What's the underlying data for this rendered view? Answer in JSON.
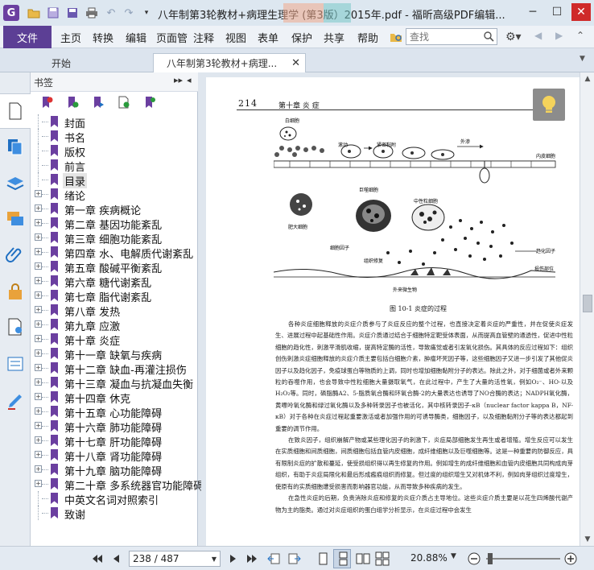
{
  "window": {
    "title": "八年制第3轮教材+病理生理学 (第3版）2015年.pdf - 福昕高级PDF编辑...",
    "app_logo_letter": "G"
  },
  "menubar": {
    "file": "文件",
    "items": [
      "主页",
      "转换",
      "编辑",
      "页面管",
      "注释",
      "视图",
      "表单",
      "保护",
      "共享",
      "帮助"
    ],
    "search_placeholder": "查找"
  },
  "tabs": {
    "start": "开始",
    "doc": "八年制第3轮教材+病理..."
  },
  "bookmarks": {
    "title": "书签",
    "items": [
      {
        "label": "封面",
        "expandable": false
      },
      {
        "label": "书名",
        "expandable": false
      },
      {
        "label": "版权",
        "expandable": false
      },
      {
        "label": "前言",
        "expandable": false
      },
      {
        "label": "目录",
        "expandable": false,
        "selected": true
      },
      {
        "label": "绪论",
        "expandable": true
      },
      {
        "label": "第一章  疾病概论",
        "expandable": true
      },
      {
        "label": "第二章  基因功能紊乱",
        "expandable": true
      },
      {
        "label": "第三章  细胞功能紊乱",
        "expandable": true
      },
      {
        "label": "第四章  水、电解质代谢紊乱",
        "expandable": true
      },
      {
        "label": "第五章  酸碱平衡紊乱",
        "expandable": true
      },
      {
        "label": "第六章  糖代谢紊乱",
        "expandable": true
      },
      {
        "label": "第七章  脂代谢紊乱",
        "expandable": true
      },
      {
        "label": "第八章  发热",
        "expandable": true
      },
      {
        "label": "第九章  应激",
        "expandable": true
      },
      {
        "label": "第十章  炎症",
        "expandable": true
      },
      {
        "label": "第十一章  缺氧与疾病",
        "expandable": true
      },
      {
        "label": "第十二章  缺血-再灌注损伤",
        "expandable": true
      },
      {
        "label": "第十三章  凝血与抗凝血失衡",
        "expandable": true
      },
      {
        "label": "第十四章  休克",
        "expandable": true
      },
      {
        "label": "第十五章  心功能障碍",
        "expandable": true
      },
      {
        "label": "第十六章  肺功能障碍",
        "expandable": true
      },
      {
        "label": "第十七章  肝功能障碍",
        "expandable": true
      },
      {
        "label": "第十八章  肾功能障碍",
        "expandable": true
      },
      {
        "label": "第十九章  脑功能障碍",
        "expandable": true
      },
      {
        "label": "第二十章  多系统器官功能障碍",
        "expandable": true
      },
      {
        "label": "中英文名词对照索引",
        "expandable": false
      },
      {
        "label": "致谢",
        "expandable": false
      }
    ]
  },
  "page": {
    "number": "214",
    "header": "第十章    炎    症",
    "figure_labels": {
      "white_cell": "白细胞",
      "rolling": "滚动",
      "tight_adhesion": "紧密黏附",
      "migration": "外渗",
      "endothelial": "内皮细胞",
      "mast_cell": "肥大细胞",
      "macrophage": "巨噬细胞",
      "neutrophil": "中性粒细胞",
      "cytokine": "细胞因子",
      "tissue_repair": "组织修复",
      "damage": "趋化因子",
      "microbe": "外来微生物",
      "injury_site": "损伤部位"
    },
    "caption": "图 10-1    炎症的过程",
    "paragraphs": [
      "各种炎症细胞释放的炎症介质参与了炎症反应的整个过程，也直接决定着炎症的严重性，并在促使炎症发生、进展过程中起基础性作用。炎症介质通过结合于细胞特定靶受体表面，从而提高血管壁的通透性，促进中性粒细胞的趋化性，刺激平滑肌收缩，提高特定酶的活性，导致痛觉或者引发氧化损伤。其具体的反应过程如下：组织创伤刺激炎症细胞释放的炎症介质主要包括白细胞介素，肿瘤坏死因子等，这些细胞因子又进一步引发了其他促炎因子以及趋化因子，免疫球蛋白等物质的上调，同时也增加细胞黏附分子的表达。除此之外，对于细菌或者外来颗粒的吞噬作用，也会导致中性粒细胞大量摄取氧气，在此过程中，产生了大量的活性氧，例如O₂⁻、HO·以及H₂O₂等。同时，磷脂酶A2、5-脂质氧合酶和环氧合酶-2的大量表达也诱导了NO合酶的表达；NADPH氧化酶，黄嘌呤氧化酶和绿过氧化酶以及多种转录因子也被活化，其中核转录因子-κB（nuclear factor kappa B，NF-κB）对于各种在炎症过程起重要激活或者加强作用的可诱导酶类，细胞因子，以及细胞黏附分子等的表达都起到重要的调节作用。",
      "在致炎因子，组织崩解产物或某些理化因子的刺激下，炎症局部细胞发生再生或者增殖。增生反应可以发生在实质细胞和间质细胞，间质细胞包括血管内皮细胞，成纤维细胞以及巨噬细胞等。这是一种重要的防御反应，具有限制炎症的扩散和蔓延，使受损组织得以再生修复的作用。例如增生的成纤维细胞和血管内皮细胞共同构成肉芽组织，有助于炎症局限化和最后形成瘢痕组织而修复。但过度的组织增生又对机体不利，例如肉芽组织过度增生，使原有的实质细胞遭受损害而影响器官功能，从而导致多种疾病的发生。",
      "在急性炎症的后期，负责消除炎症和修复的炎症介质占主导地位。这些炎症介质主要是以花生四烯酸代谢产物为主的脂类。通过对炎症组织的蛋白组学分析显示，在炎症过程中会发生"
    ]
  },
  "statusbar": {
    "page_value": "238 / 487",
    "zoom": "20.88%"
  },
  "colors": {
    "brand": "#5c3f95",
    "bookmark_flag": "#6b3fa0"
  }
}
